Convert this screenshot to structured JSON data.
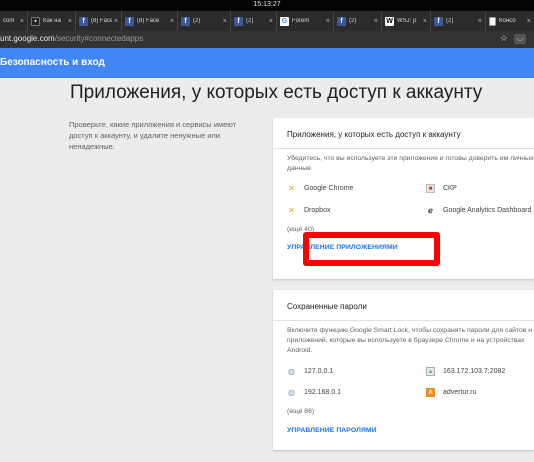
{
  "os": {
    "time": "15:13:27"
  },
  "tabs": [
    {
      "label": "com",
      "favicon": "page-icon"
    },
    {
      "label": "Как на",
      "favicon": "dark-icon"
    },
    {
      "label": "(8) Face",
      "favicon": "facebook-icon"
    },
    {
      "label": "(8) Face",
      "favicon": "facebook-icon"
    },
    {
      "label": "(2) ",
      "favicon": "facebook-icon"
    },
    {
      "label": "(2) ",
      "favicon": "facebook-icon"
    },
    {
      "label": "Forem",
      "favicon": "search-icon"
    },
    {
      "label": "(2) ",
      "favicon": "facebook-icon"
    },
    {
      "label": "WSJ: p",
      "favicon": "wsj-icon"
    },
    {
      "label": "(2) ",
      "favicon": "facebook-icon"
    },
    {
      "label": "Консо",
      "favicon": "page-icon"
    }
  ],
  "address": {
    "host": "unt.google.com",
    "path": "/security#connectedapps"
  },
  "appbar": {
    "title": "Безопасность и вход",
    "color": "#4285f4"
  },
  "page": {
    "heading": "Приложения, у которых есть доступ к аккаунту",
    "description": "Проверьте, какие приложения и сервисы имеют доступ к аккаунту, и удалите ненужные или ненадежные."
  },
  "apps_card": {
    "title": "Приложения, у которых есть доступ к аккаунту",
    "text": "Убедитесь, что вы используете эти приложения и готовы доверить им личные данные.",
    "items": [
      {
        "label": "Google Chrome",
        "icon": "wrench-icon"
      },
      {
        "label": "СКР",
        "icon": "app-icon"
      },
      {
        "label": "Dropbox",
        "icon": "wrench-icon"
      },
      {
        "label": "Google Analytics Dashboard",
        "icon": "analytics-icon"
      }
    ],
    "more": "(ещё 40)",
    "link": "УПРАВЛЕНИЕ ПРИЛОЖЕНИЯМИ"
  },
  "passwords_card": {
    "title": "Сохраненные пароли",
    "text": "Включите функцию Google Smart Lock, чтобы сохранять пароли для сайтов и приложений, которые вы используете в браузере Chrome и на устройствах Android.",
    "items": [
      {
        "label": "127.0.0.1",
        "icon": "globe-icon"
      },
      {
        "label": "163.172.103.7:2082",
        "icon": "image-icon"
      },
      {
        "label": "192.168.0.1",
        "icon": "globe-icon"
      },
      {
        "label": "advertur.ru",
        "icon": "site-icon"
      }
    ],
    "more": "(ещё 86)",
    "link": "УПРАВЛЕНИЕ ПАРОЛЯМИ"
  },
  "colors": {
    "link": "#1a73e8",
    "highlight": "#ff0000"
  }
}
